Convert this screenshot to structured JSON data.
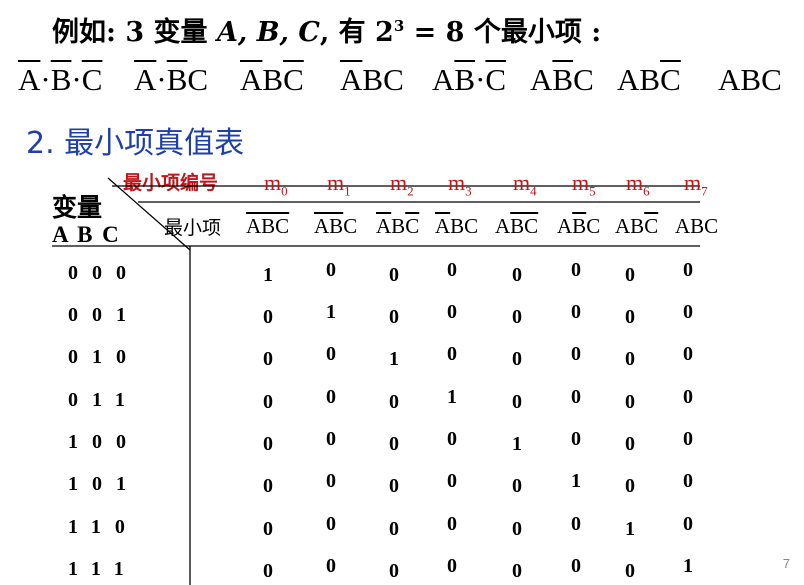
{
  "intro": {
    "prefix": "例如: 3 变量 ",
    "vars": "A, B, C",
    "suffix": ", 有 2",
    "exp": "3",
    "rest": " = 8 个最小项 :"
  },
  "top_terms": [
    [
      {
        "t": "A",
        "bar": true
      },
      {
        "t": "·"
      },
      {
        "t": "B",
        "bar": true
      },
      {
        "t": "·"
      },
      {
        "t": "C",
        "bar": true
      }
    ],
    [
      {
        "t": "A",
        "bar": true
      },
      {
        "t": "·"
      },
      {
        "t": "B",
        "bar": true
      },
      {
        "t": "C"
      }
    ],
    [
      {
        "t": "A",
        "bar": true
      },
      {
        "t": "B"
      },
      {
        "t": "C",
        "bar": true
      }
    ],
    [
      {
        "t": "A",
        "bar": true
      },
      {
        "t": "BC"
      }
    ],
    [
      {
        "t": "A"
      },
      {
        "t": "B",
        "bar": true
      },
      {
        "t": "·"
      },
      {
        "t": "C",
        "bar": true
      }
    ],
    [
      {
        "t": "A"
      },
      {
        "t": "B",
        "bar": true
      },
      {
        "t": "C"
      }
    ],
    [
      {
        "t": "AB"
      },
      {
        "t": "C",
        "bar": true
      }
    ],
    [
      {
        "t": "ABC"
      }
    ]
  ],
  "heading": "2. 最小项真值表",
  "table": {
    "code_label": "最小项编号",
    "var_label": "变量",
    "var_names": "A B C",
    "minterm_label": "最小项",
    "codes": [
      {
        "m": "m",
        "i": "0"
      },
      {
        "m": "m",
        "i": "1"
      },
      {
        "m": "m",
        "i": "2"
      },
      {
        "m": "m",
        "i": "3"
      },
      {
        "m": "m",
        "i": "4"
      },
      {
        "m": "m",
        "i": "5"
      },
      {
        "m": "m",
        "i": "6"
      },
      {
        "m": "m",
        "i": "7"
      }
    ],
    "minterms": [
      [
        {
          "t": "ABC",
          "bar": true
        }
      ],
      [
        {
          "t": "AB",
          "bar": true
        },
        {
          "t": "C"
        }
      ],
      [
        {
          "t": "A",
          "bar": true
        },
        {
          "t": "B"
        },
        {
          "t": "C",
          "bar": true
        }
      ],
      [
        {
          "t": "A",
          "bar": true
        },
        {
          "t": "BC"
        }
      ],
      [
        {
          "t": "A"
        },
        {
          "t": "BC",
          "bar": true
        }
      ],
      [
        {
          "t": "A"
        },
        {
          "t": "B",
          "bar": true
        },
        {
          "t": "C"
        }
      ],
      [
        {
          "t": "AB"
        },
        {
          "t": "C",
          "bar": true
        }
      ],
      [
        {
          "t": "ABC"
        }
      ]
    ],
    "rows": [
      {
        "in": "000",
        "out": [
          "1",
          "0",
          "0",
          "0",
          "0",
          "0",
          "0",
          "0"
        ]
      },
      {
        "in": "001",
        "out": [
          "0",
          "1",
          "0",
          "0",
          "0",
          "0",
          "0",
          "0"
        ]
      },
      {
        "in": "010",
        "out": [
          "0",
          "0",
          "1",
          "0",
          "0",
          "0",
          "0",
          "0"
        ]
      },
      {
        "in": "011",
        "out": [
          "0",
          "0",
          "0",
          "1",
          "0",
          "0",
          "0",
          "0"
        ]
      },
      {
        "in": "100",
        "out": [
          "0",
          "0",
          "0",
          "0",
          "1",
          "0",
          "0",
          "0"
        ]
      },
      {
        "in": "101",
        "out": [
          "0",
          "0",
          "0",
          "0",
          "0",
          "1",
          "0",
          "0"
        ]
      },
      {
        "in": "110",
        "out": [
          "0",
          "0",
          "0",
          "0",
          "0",
          "0",
          "1",
          "0"
        ]
      },
      {
        "in": "111",
        "out": [
          "0",
          "0",
          "0",
          "0",
          "0",
          "0",
          "0",
          "1"
        ]
      }
    ]
  },
  "page_number": "7",
  "colors": {
    "heading": "#1f3fa8",
    "code_label": "#c0161b"
  }
}
